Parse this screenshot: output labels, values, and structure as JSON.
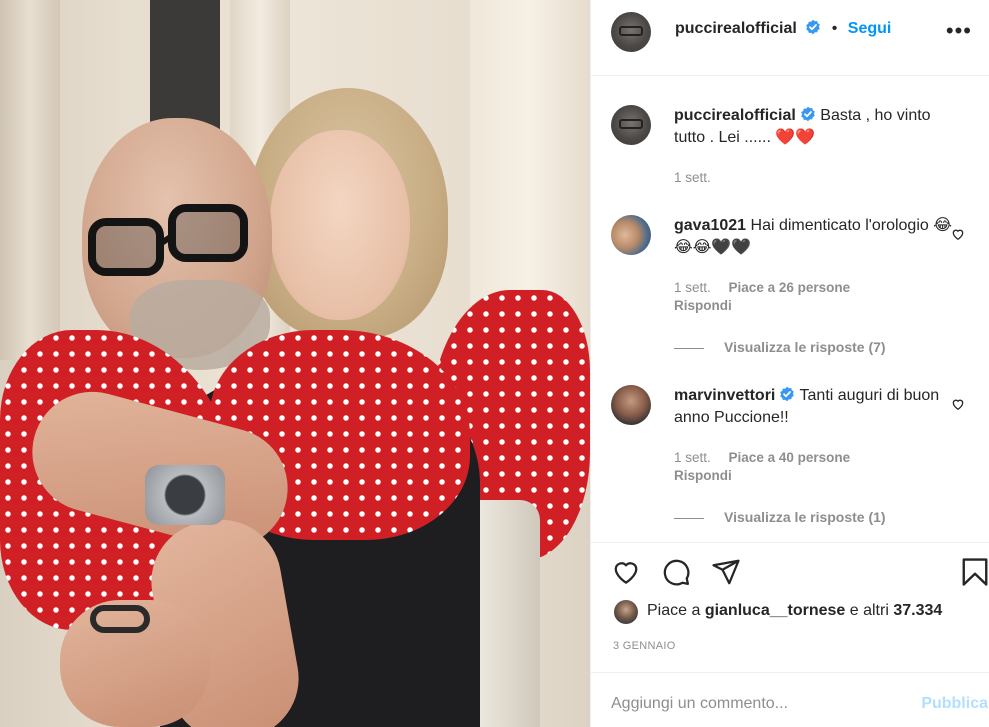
{
  "post": {
    "photo": {
      "description": "",
      "accent_colors": {
        "dress": "#d11f26",
        "shirt": "#1e1d1f"
      }
    },
    "author": {
      "username": "puccirealofficial",
      "verified": true,
      "follow_label": "Segui",
      "separator": "•",
      "more_icon": "more-horizontal-icon"
    },
    "caption": {
      "username": "puccirealofficial",
      "text": "Basta , ho vinto tutto . Lei ......",
      "emoji": "❤️❤️",
      "time": "1 sett."
    },
    "comments": [
      {
        "username": "gava1021",
        "text": "Hai dimenticato l'orologio 😂😂😂🖤🖤",
        "time": "1 sett.",
        "likes": "Piace a 26 persone",
        "reply": "Rispondi",
        "view_replies": "Visualizza le risposte (7)"
      },
      {
        "username": "marvinvettori",
        "verified": true,
        "text": "Tanti auguri di buon anno Puccione!!",
        "time": "1 sett.",
        "likes": "Piace a 40 persone",
        "reply": "Rispondi",
        "view_replies": "Visualizza le risposte (1)"
      }
    ],
    "likes": {
      "prefix": "Piace a ",
      "user": "gianluca__tornese",
      "suffix": " e altri ",
      "count": "37.334"
    },
    "date": "3 GENNAIO",
    "add_comment": {
      "placeholder": "Aggiungi un commento...",
      "publish_label": "Pubblica"
    },
    "colors": {
      "link_blue": "#0095f6",
      "publish_disabled": "#b2dffc",
      "muted": "#8e8e8e",
      "text": "#262626"
    }
  }
}
